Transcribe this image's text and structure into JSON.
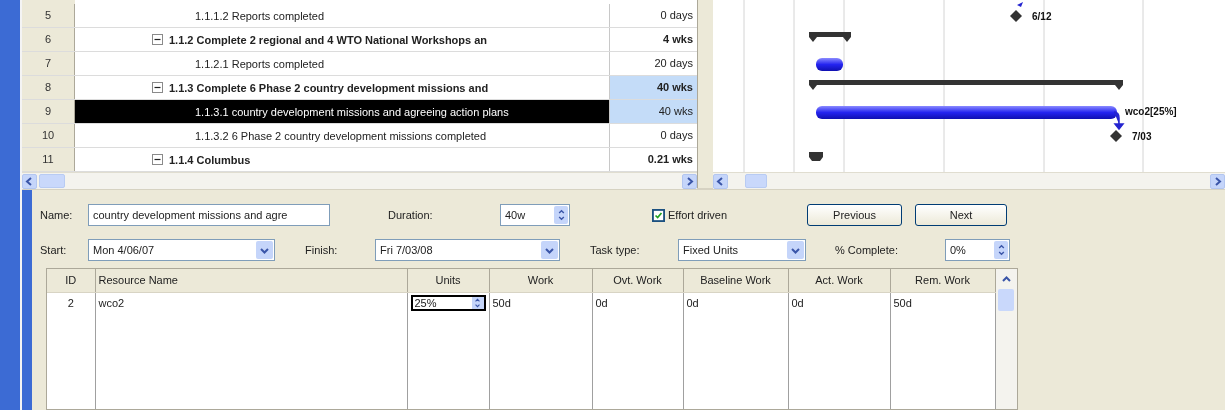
{
  "task_table": {
    "rows": [
      {
        "id": "5",
        "name": "1.1.1.2 Reports completed",
        "duration": "0 days",
        "kind": "milestone",
        "selected": false,
        "duration_selected": false,
        "bar_label": "6/12"
      },
      {
        "id": "6",
        "name": "1.1.2 Complete 2 regional and  4 WTO National Workshops an",
        "duration": "4 wks",
        "kind": "summary",
        "expanded": true,
        "selected": false,
        "duration_selected": false,
        "children": [
          {
            "id": "7",
            "name": "1.1.2.1 Reports completed",
            "duration": "20 days",
            "kind": "task",
            "selected": false,
            "duration_selected": false
          }
        ]
      },
      {
        "id": "8",
        "name": "1.1.3 Complete 6 Phase 2 country development missions and",
        "duration": "40 wks",
        "kind": "summary",
        "expanded": true,
        "selected": false,
        "duration_selected": true,
        "children": [
          {
            "id": "9",
            "name": "1.1.3.1 country development missions and agreeing action plans",
            "duration": "40 wks",
            "kind": "task",
            "selected": true,
            "duration_selected": true,
            "bar_label": "wco2[25%]"
          },
          {
            "id": "10",
            "name": "1.1.3.2  6 Phase 2 country development missions completed",
            "duration": "0 days",
            "kind": "milestone",
            "selected": false,
            "duration_selected": false,
            "bar_label": "7/03"
          }
        ]
      },
      {
        "id": "11",
        "name": "1.1.4 Columbus",
        "duration": "0.21 wks",
        "kind": "summary",
        "expanded": true,
        "selected": false,
        "duration_selected": false
      }
    ]
  },
  "task_form": {
    "name_label": "Name:",
    "name_value": "country development missions and agre",
    "duration_label": "Duration:",
    "duration_value": "40w",
    "effort_driven": {
      "label": "Effort driven",
      "checked": true
    },
    "buttons": [
      "Previous",
      "Next"
    ],
    "start_label": "Start:",
    "start_value": "Mon 4/06/07",
    "finish_label": "Finish:",
    "finish_value": "Fri 7/03/08",
    "task_type_label": "Task type:",
    "task_type_value": "Fixed Units",
    "complete_label": "% Complete:",
    "complete_value": "0%"
  },
  "resource_grid": {
    "columns": [
      "ID",
      "Resource Name",
      "Units",
      "Work",
      "Ovt. Work",
      "Baseline Work",
      "Act. Work",
      "Rem. Work"
    ],
    "rows": [
      {
        "cells": [
          {
            "text": "2",
            "editing": false
          },
          {
            "text": "wco2",
            "editing": false
          },
          {
            "text": "25%",
            "editing": true
          },
          {
            "text": "50d",
            "editing": false
          },
          {
            "text": "0d",
            "editing": false
          },
          {
            "text": "0d",
            "editing": false
          },
          {
            "text": "0d",
            "editing": false
          },
          {
            "text": "50d",
            "editing": false
          }
        ]
      }
    ]
  }
}
